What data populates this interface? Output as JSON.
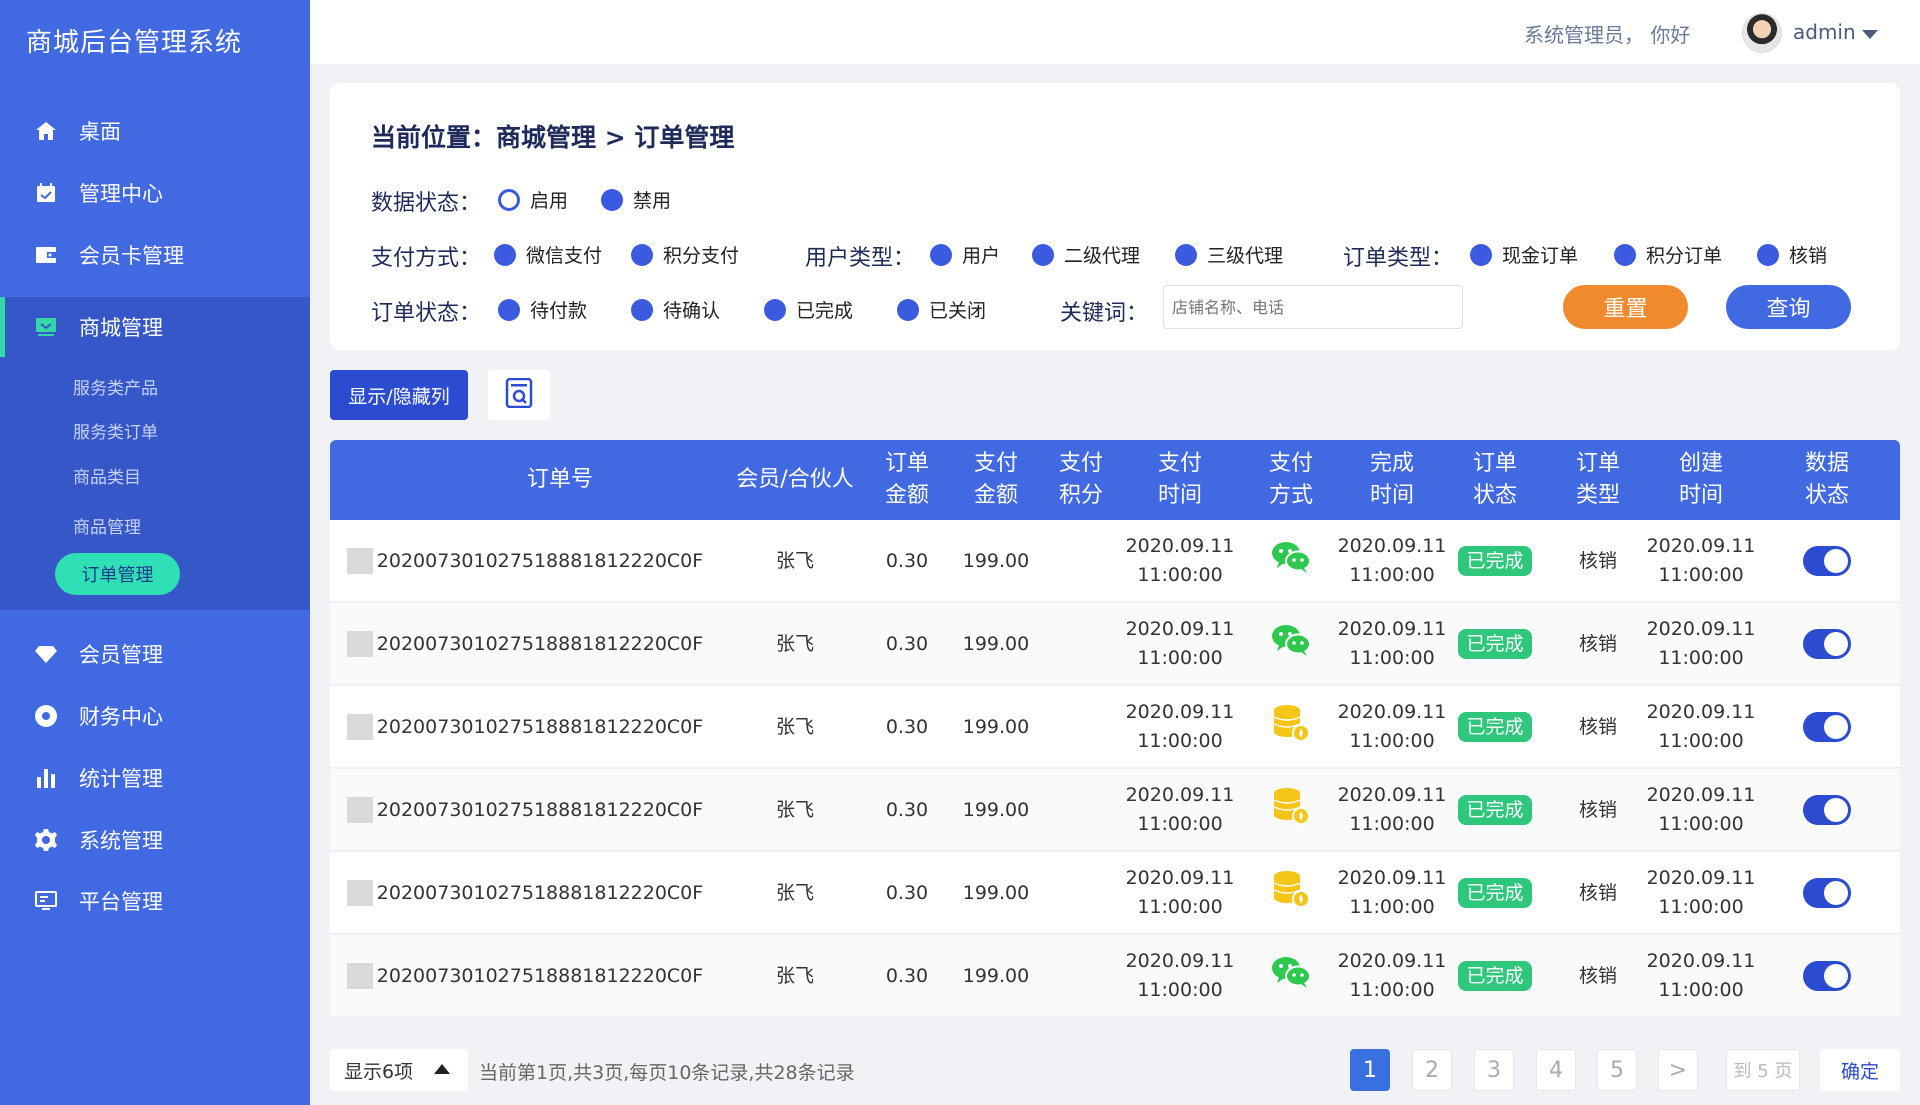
{
  "app": {
    "title": "商城后台管理系统"
  },
  "colors": {
    "sidebar": "#4169e1",
    "accent": "#2b4bd0",
    "reset": "#f08a2c",
    "query": "#4169e1",
    "success": "#2ec77b",
    "submenu_active": "#2fe0b4"
  },
  "sidebar": {
    "items": [
      {
        "label": "桌面",
        "icon": "home-icon"
      },
      {
        "label": "管理中心",
        "icon": "calendar-check-icon"
      },
      {
        "label": "会员卡管理",
        "icon": "card-icon"
      },
      {
        "label": "商城管理",
        "icon": "mall-icon"
      },
      {
        "label": "会员管理",
        "icon": "diamond-icon"
      },
      {
        "label": "财务中心",
        "icon": "finance-icon"
      },
      {
        "label": "统计管理",
        "icon": "bar-chart-icon"
      },
      {
        "label": "系统管理",
        "icon": "gear-icon"
      },
      {
        "label": "平台管理",
        "icon": "monitor-icon"
      }
    ],
    "sub_items": [
      "服务类产品",
      "服务类订单",
      "商品类目",
      "商品管理",
      "订单管理"
    ]
  },
  "topbar": {
    "greeting": "系统管理员， 你好",
    "user": "admin"
  },
  "filter": {
    "breadcrumb": "当前位置：商城管理 > 订单管理",
    "data_status": {
      "label": "数据状态：",
      "options": [
        "启用",
        "禁用"
      ]
    },
    "pay_method": {
      "label": "支付方式：",
      "options": [
        "微信支付",
        "积分支付"
      ]
    },
    "user_type": {
      "label": "用户类型：",
      "options": [
        "用户",
        "二级代理",
        "三级代理"
      ]
    },
    "order_type": {
      "label": "订单类型：",
      "options": [
        "现金订单",
        "积分订单",
        "核销"
      ]
    },
    "order_status": {
      "label": "订单状态：",
      "options": [
        "待付款",
        "待确认",
        "已完成",
        "已关闭"
      ]
    },
    "keyword": {
      "label": "关键词：",
      "placeholder": "店铺名称、电话"
    },
    "reset_label": "重置",
    "query_label": "查询"
  },
  "toolbar": {
    "toggle_label": "显示/隐藏列",
    "export_icon": "document-search-icon"
  },
  "table": {
    "headers": [
      "订单号",
      "会员/合伙人",
      "订单\n金额",
      "支付\n金额",
      "支付\n积分",
      "支付\n时间",
      "支付\n方式",
      "完成\n时间",
      "订单\n状态",
      "订单\n类型",
      "创建\n时间",
      "数据\n状态"
    ],
    "rows": [
      {
        "order_no": "2020073010275188818122​20C0F",
        "member": "张飞",
        "order_amount": "0.30",
        "pay_amount": "199.00",
        "pay_points": "",
        "pay_time": [
          "2020.09.11",
          "11:00:00"
        ],
        "pay_method": "wechat",
        "finish_time": [
          "2020.09.11",
          "11:00:00"
        ],
        "status": "已完成",
        "type": "核销",
        "create_time": [
          "2020.09.11",
          "11:00:00"
        ],
        "enabled": true
      },
      {
        "order_no": "202007301027518881812220C0F",
        "member": "张飞",
        "order_amount": "0.30",
        "pay_amount": "199.00",
        "pay_points": "",
        "pay_time": [
          "2020.09.11",
          "11:00:00"
        ],
        "pay_method": "wechat",
        "finish_time": [
          "2020.09.11",
          "11:00:00"
        ],
        "status": "已完成",
        "type": "核销",
        "create_time": [
          "2020.09.11",
          "11:00:00"
        ],
        "enabled": true
      },
      {
        "order_no": "202007301027518881812220C0F",
        "member": "张飞",
        "order_amount": "0.30",
        "pay_amount": "199.00",
        "pay_points": "",
        "pay_time": [
          "2020.09.11",
          "11:00:00"
        ],
        "pay_method": "points",
        "finish_time": [
          "2020.09.11",
          "11:00:00"
        ],
        "status": "已完成",
        "type": "核销",
        "create_time": [
          "2020.09.11",
          "11:00:00"
        ],
        "enabled": true
      },
      {
        "order_no": "202007301027518881812220C0F",
        "member": "张飞",
        "order_amount": "0.30",
        "pay_amount": "199.00",
        "pay_points": "",
        "pay_time": [
          "2020.09.11",
          "11:00:00"
        ],
        "pay_method": "points",
        "finish_time": [
          "2020.09.11",
          "11:00:00"
        ],
        "status": "已完成",
        "type": "核销",
        "create_time": [
          "2020.09.11",
          "11:00:00"
        ],
        "enabled": true
      },
      {
        "order_no": "202007301027518881812220C0F",
        "member": "张飞",
        "order_amount": "0.30",
        "pay_amount": "199.00",
        "pay_points": "",
        "pay_time": [
          "2020.09.11",
          "11:00:00"
        ],
        "pay_method": "points",
        "finish_time": [
          "2020.09.11",
          "11:00:00"
        ],
        "status": "已完成",
        "type": "核销",
        "create_time": [
          "2020.09.11",
          "11:00:00"
        ],
        "enabled": true
      },
      {
        "order_no": "202007301027518881812220C0F",
        "member": "张飞",
        "order_amount": "0.30",
        "pay_amount": "199.00",
        "pay_points": "",
        "pay_time": [
          "2020.09.11",
          "11:00:00"
        ],
        "pay_method": "wechat",
        "finish_time": [
          "2020.09.11",
          "11:00:00"
        ],
        "status": "已完成",
        "type": "核销",
        "create_time": [
          "2020.09.11",
          "11:00:00"
        ],
        "enabled": true
      }
    ]
  },
  "pagination": {
    "show_count": "显示6项",
    "info": "当前第1页,共3页,每页10条记录,共28条记录",
    "pages": [
      "1",
      "2",
      "3",
      "4",
      "5"
    ],
    "next": ">",
    "goto": "到 5 页",
    "confirm": "确定"
  }
}
